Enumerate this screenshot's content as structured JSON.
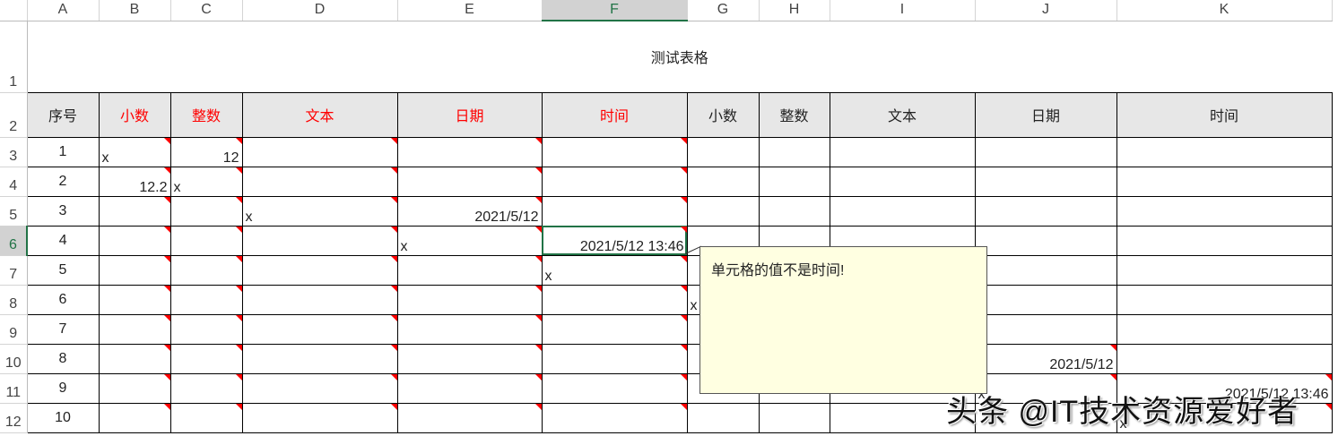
{
  "columns": [
    "A",
    "B",
    "C",
    "D",
    "E",
    "F",
    "G",
    "H",
    "I",
    "J",
    "K"
  ],
  "rows": [
    "1",
    "2",
    "3",
    "4",
    "5",
    "6",
    "7",
    "8",
    "9",
    "10",
    "11",
    "12"
  ],
  "title": "测试表格",
  "headers": [
    "序号",
    "小数",
    "整数",
    "文本",
    "日期",
    "时间",
    "小数",
    "整数",
    "文本",
    "日期",
    "时间"
  ],
  "header_red_color": "#ff0000",
  "data": [
    [
      "1",
      "x",
      "12",
      "",
      "",
      "",
      "",
      "",
      "",
      "",
      ""
    ],
    [
      "2",
      "12.2",
      "x",
      "",
      "",
      "",
      "",
      "",
      "",
      "",
      ""
    ],
    [
      "3",
      "",
      "",
      "x",
      "2021/5/12",
      "",
      "",
      "",
      "",
      "",
      ""
    ],
    [
      "4",
      "",
      "",
      "",
      "x",
      "2021/5/12 13:46",
      "",
      "",
      "",
      "",
      ""
    ],
    [
      "5",
      "",
      "",
      "",
      "",
      "x",
      "",
      "",
      "",
      "",
      ""
    ],
    [
      "6",
      "",
      "",
      "",
      "",
      "",
      "x",
      "",
      "",
      "",
      ""
    ],
    [
      "7",
      "",
      "",
      "",
      "",
      "",
      "",
      "",
      "",
      "",
      ""
    ],
    [
      "8",
      "",
      "",
      "",
      "",
      "",
      "",
      "",
      "",
      "2021/5/12",
      ""
    ],
    [
      "9",
      "",
      "",
      "",
      "",
      "",
      "",
      "",
      "",
      "x",
      "2021/5/12 13:46"
    ],
    [
      "10",
      "",
      "",
      "",
      "",
      "",
      "",
      "",
      "",
      "",
      "x"
    ]
  ],
  "comment": "单元格的值不是时间!",
  "watermark": "头条 @IT技术资源爱好者"
}
